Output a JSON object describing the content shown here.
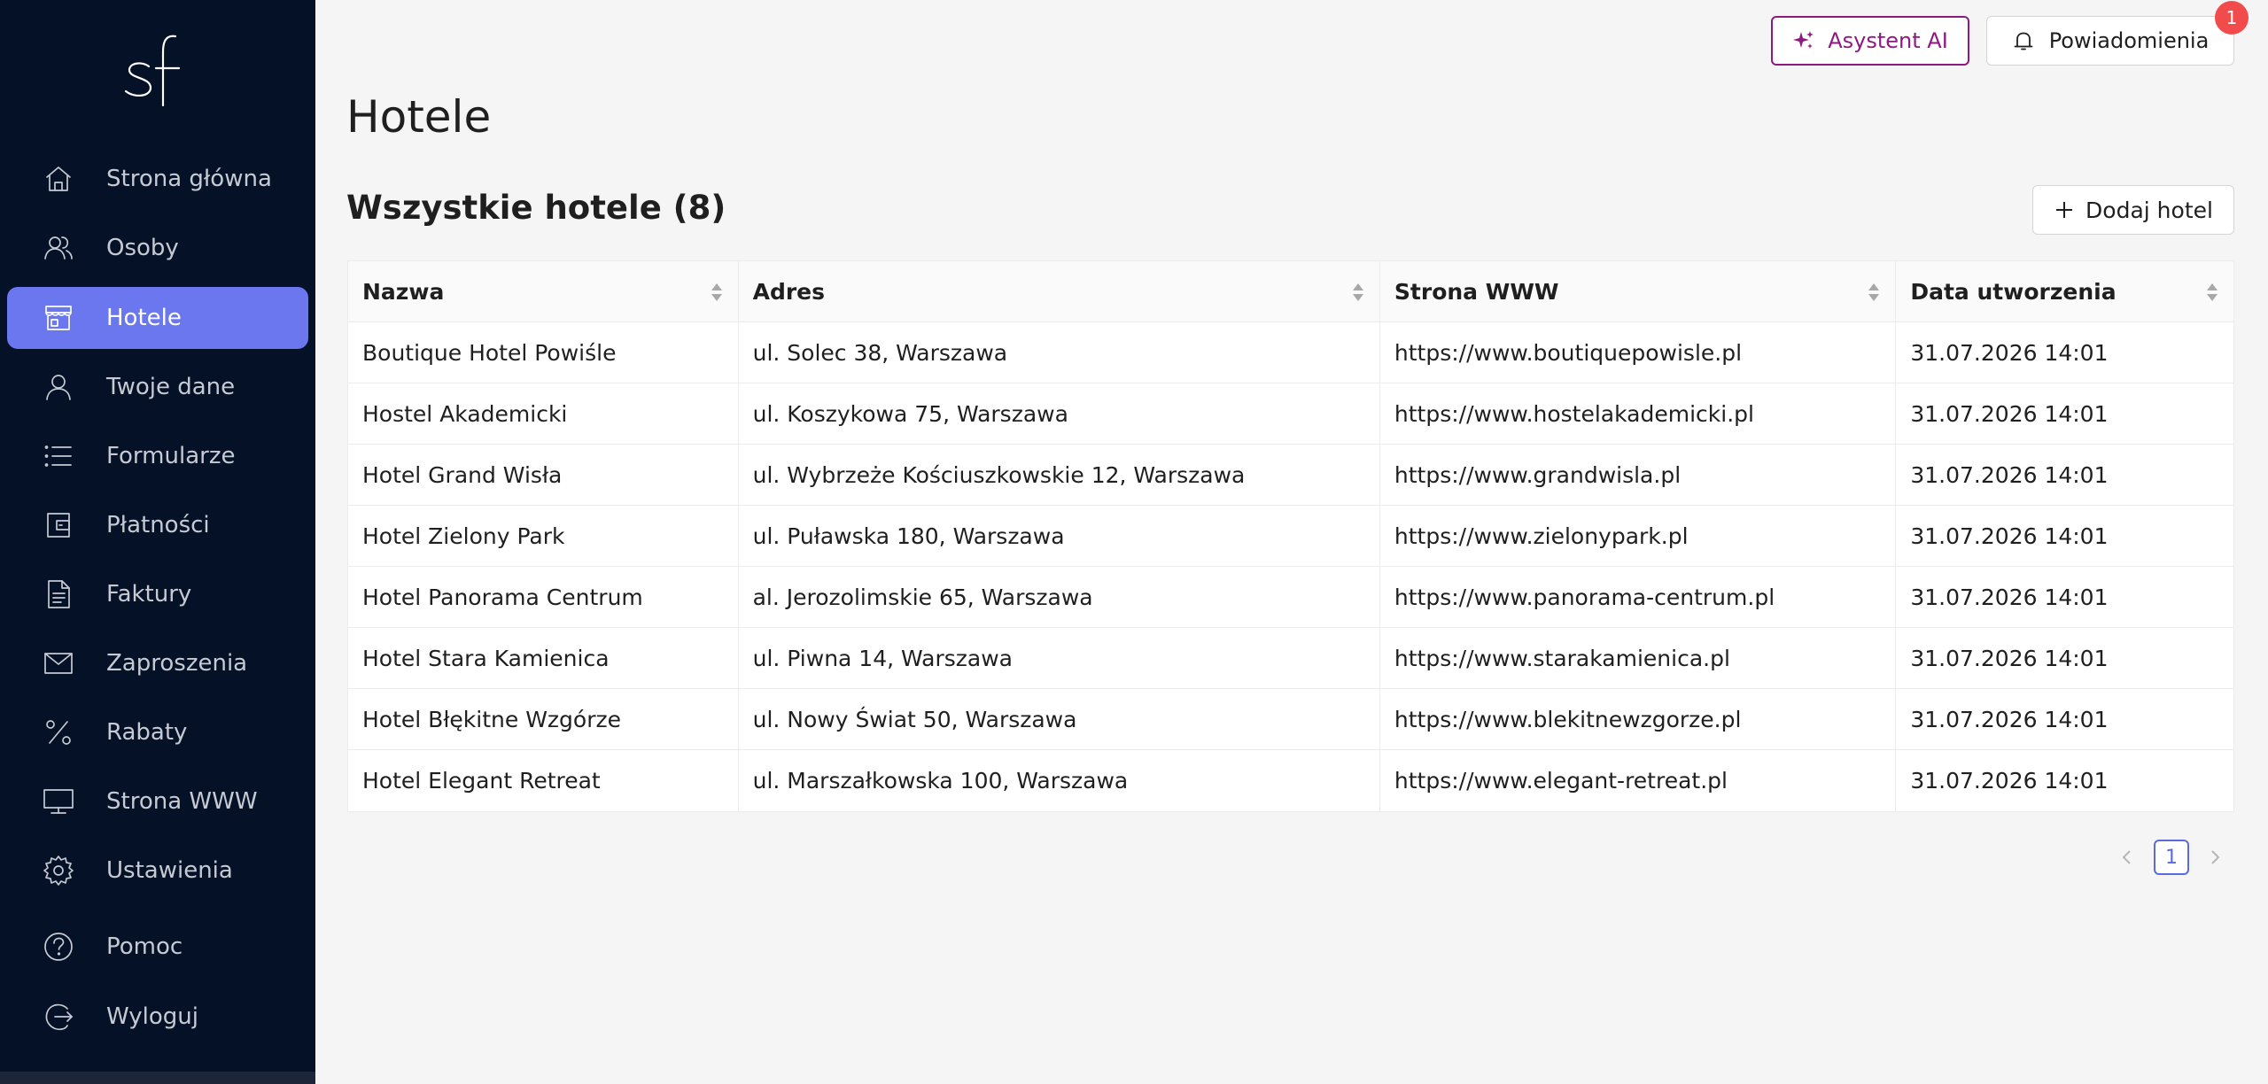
{
  "sidebar": {
    "logo_text": "sf",
    "items": [
      {
        "label": "Strona główna",
        "icon": "home-icon"
      },
      {
        "label": "Osoby",
        "icon": "people-icon"
      },
      {
        "label": "Hotele",
        "icon": "store-icon",
        "active": true
      },
      {
        "label": "Twoje dane",
        "icon": "user-icon"
      },
      {
        "label": "Formularze",
        "icon": "list-icon"
      },
      {
        "label": "Płatności",
        "icon": "wallet-icon"
      },
      {
        "label": "Faktury",
        "icon": "document-icon"
      },
      {
        "label": "Zaproszenia",
        "icon": "mail-icon"
      },
      {
        "label": "Rabaty",
        "icon": "percent-icon"
      },
      {
        "label": "Strona WWW",
        "icon": "monitor-icon"
      },
      {
        "label": "Ustawienia",
        "icon": "gear-icon"
      },
      {
        "label": "Pomoc",
        "icon": "help-icon"
      },
      {
        "label": "Wyloguj",
        "icon": "logout-icon"
      }
    ]
  },
  "topbar": {
    "ai_label": "Asystent AI",
    "notifications_label": "Powiadomienia",
    "notifications_count": "1"
  },
  "page": {
    "title": "Hotele",
    "section_title": "Wszystkie hotele (8)",
    "add_button_label": "Dodaj hotel"
  },
  "table": {
    "columns": [
      "Nazwa",
      "Adres",
      "Strona WWW",
      "Data utworzenia"
    ],
    "rows": [
      [
        "Boutique Hotel Powiśle",
        "ul. Solec 38, Warszawa",
        "https://www.boutiquepowisle.pl",
        "31.07.2026 14:01"
      ],
      [
        "Hostel Akademicki",
        "ul. Koszykowa 75, Warszawa",
        "https://www.hostelakademicki.pl",
        "31.07.2026 14:01"
      ],
      [
        "Hotel Grand Wisła",
        "ul. Wybrzeże Kościuszkowskie 12, Warszawa",
        "https://www.grandwisla.pl",
        "31.07.2026 14:01"
      ],
      [
        "Hotel Zielony Park",
        "ul. Puławska 180, Warszawa",
        "https://www.zielonypark.pl",
        "31.07.2026 14:01"
      ],
      [
        "Hotel Panorama Centrum",
        "al. Jerozolimskie 65, Warszawa",
        "https://www.panorama-centrum.pl",
        "31.07.2026 14:01"
      ],
      [
        "Hotel Stara Kamienica",
        "ul. Piwna 14, Warszawa",
        "https://www.starakamienica.pl",
        "31.07.2026 14:01"
      ],
      [
        "Hotel Błękitne Wzgórze",
        "ul. Nowy Świat 50, Warszawa",
        "https://www.blekitnewzgorze.pl",
        "31.07.2026 14:01"
      ],
      [
        "Hotel Elegant Retreat",
        "ul. Marszałkowska 100, Warszawa",
        "https://www.elegant-retreat.pl",
        "31.07.2026 14:01"
      ]
    ]
  },
  "pagination": {
    "current_page": "1"
  },
  "colors": {
    "sidebar_bg": "#051127",
    "active_item": "#6b77ee",
    "ai_accent": "#8c1a80",
    "badge": "#f24b4b",
    "pager_accent": "#5a6adf"
  }
}
